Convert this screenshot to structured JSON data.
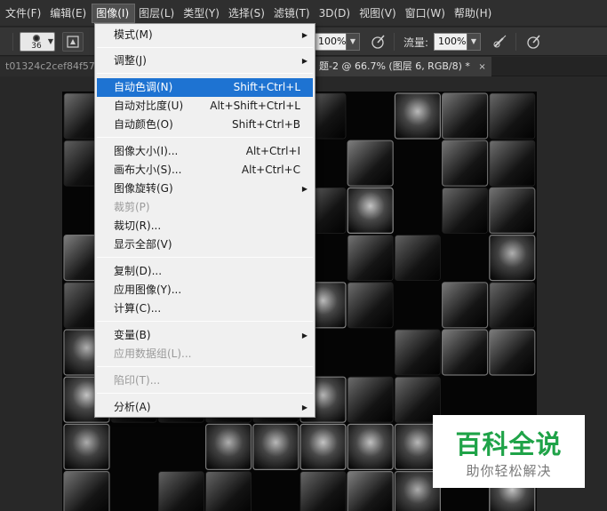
{
  "menubar": {
    "items": [
      {
        "label": "文件(F)"
      },
      {
        "label": "编辑(E)"
      },
      {
        "label": "图像(I)"
      },
      {
        "label": "图层(L)"
      },
      {
        "label": "类型(Y)"
      },
      {
        "label": "选择(S)"
      },
      {
        "label": "滤镜(T)"
      },
      {
        "label": "3D(D)"
      },
      {
        "label": "视图(V)"
      },
      {
        "label": "窗口(W)"
      },
      {
        "label": "帮助(H)"
      }
    ],
    "active_index": 2
  },
  "options_bar": {
    "brush_size": "36",
    "opacity_value": "100%",
    "flow_label": "流量:",
    "flow_value": "100%"
  },
  "tabs": {
    "inactive_label": "t01324c2cef84f57",
    "active_label": "题-2 @ 66.7% (图层 6, RGB/8) *",
    "close_glyph": "×"
  },
  "image_menu": {
    "items": [
      {
        "label": "模式(M)",
        "shortcut": "",
        "submenu": true,
        "disabled": false
      },
      {
        "label": "调整(J)",
        "shortcut": "",
        "submenu": true,
        "disabled": false
      },
      {
        "label": "自动色调(N)",
        "shortcut": "Shift+Ctrl+L",
        "submenu": false,
        "disabled": false,
        "highlighted": true
      },
      {
        "label": "自动对比度(U)",
        "shortcut": "Alt+Shift+Ctrl+L",
        "submenu": false,
        "disabled": false
      },
      {
        "label": "自动颜色(O)",
        "shortcut": "Shift+Ctrl+B",
        "submenu": false,
        "disabled": false
      },
      {
        "label": "图像大小(I)...",
        "shortcut": "Alt+Ctrl+I",
        "submenu": false,
        "disabled": false
      },
      {
        "label": "画布大小(S)...",
        "shortcut": "Alt+Ctrl+C",
        "submenu": false,
        "disabled": false
      },
      {
        "label": "图像旋转(G)",
        "shortcut": "",
        "submenu": true,
        "disabled": false
      },
      {
        "label": "裁剪(P)",
        "shortcut": "",
        "submenu": false,
        "disabled": true
      },
      {
        "label": "裁切(R)...",
        "shortcut": "",
        "submenu": false,
        "disabled": false
      },
      {
        "label": "显示全部(V)",
        "shortcut": "",
        "submenu": false,
        "disabled": false
      },
      {
        "label": "复制(D)...",
        "shortcut": "",
        "submenu": false,
        "disabled": false
      },
      {
        "label": "应用图像(Y)...",
        "shortcut": "",
        "submenu": false,
        "disabled": false
      },
      {
        "label": "计算(C)...",
        "shortcut": "",
        "submenu": false,
        "disabled": false
      },
      {
        "label": "变量(B)",
        "shortcut": "",
        "submenu": true,
        "disabled": false
      },
      {
        "label": "应用数据组(L)...",
        "shortcut": "",
        "submenu": false,
        "disabled": true
      },
      {
        "label": "陷印(T)...",
        "shortcut": "",
        "submenu": false,
        "disabled": true
      },
      {
        "label": "分析(A)",
        "shortcut": "",
        "submenu": true,
        "disabled": false
      }
    ]
  },
  "watermark": {
    "title": "百科全说",
    "subtitle": "助你轻松解决",
    "title_color": "#1fa348"
  },
  "colors": {
    "menu_highlight": "#1e73d2",
    "menubar_bg": "#2f2f2f",
    "workspace_bg": "#282828"
  },
  "icons": {
    "brush_preset": "brush-preset-icon",
    "brush_panel": "brush-panel-icon",
    "airbrush": "airbrush-icon",
    "pressure": "pressure-icon",
    "submenu_arrow": "▶",
    "dropdown_arrow": "▼"
  }
}
